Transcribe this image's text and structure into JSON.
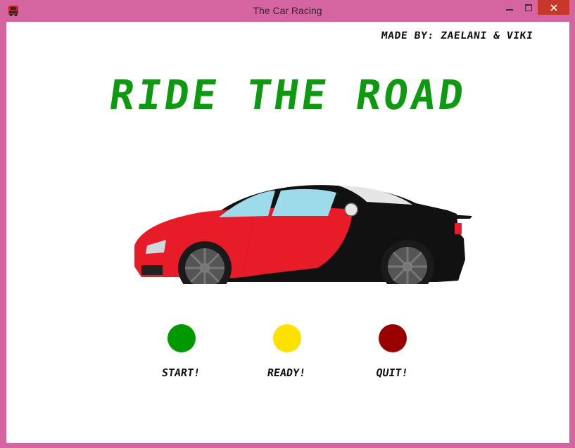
{
  "window": {
    "title": "The Car Racing",
    "controls": {
      "minimize": "🗕",
      "maximize": "☐",
      "close": "✕"
    },
    "app_icon": "car-icon",
    "frame_color": "#d465a1"
  },
  "content": {
    "credit": "MADE BY: ZAELANI & VIKI",
    "headline": "RIDE THE ROAD",
    "headline_color": "#0d9a10",
    "car_image": "sports-car",
    "buttons": [
      {
        "label": "START!",
        "color": "#009a00"
      },
      {
        "label": "READY!",
        "color": "#ffe100"
      },
      {
        "label": "QUIT!",
        "color": "#990000"
      }
    ]
  }
}
